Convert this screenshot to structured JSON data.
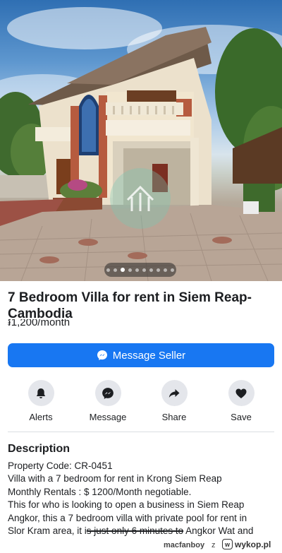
{
  "listing": {
    "title": "7 Bedroom Villa for rent in Siem Reap-Cambodia",
    "price": "៛1,200/month",
    "photo": {
      "page_index": 2,
      "page_count": 10
    }
  },
  "message_button": {
    "label": "Message Seller",
    "icon": "messenger-icon"
  },
  "actions": [
    {
      "label": "Alerts",
      "icon": "bell-icon"
    },
    {
      "label": "Message",
      "icon": "messenger-icon"
    },
    {
      "label": "Share",
      "icon": "share-arrow-icon"
    },
    {
      "label": "Save",
      "icon": "heart-icon"
    }
  ],
  "description": {
    "heading": "Description",
    "lines": [
      "Property Code: CR-0451",
      "Villa with a 7 bedroom for rent in Krong Siem Reap",
      "Monthly Rentals : $ 1200/Month negotiable.",
      "This for who is  looking to open a business in Siem Reap",
      "Angkor, this a 7 bedroom villa with private pool for rent in"
    ],
    "last_line": {
      "before": "Slor Kram area, it i",
      "struck": "s just only 6 minutes to",
      "after": " Angkor Wat and"
    }
  },
  "footer": {
    "username": "macfanboy",
    "separator": "z",
    "brand": "wykop.pl"
  }
}
